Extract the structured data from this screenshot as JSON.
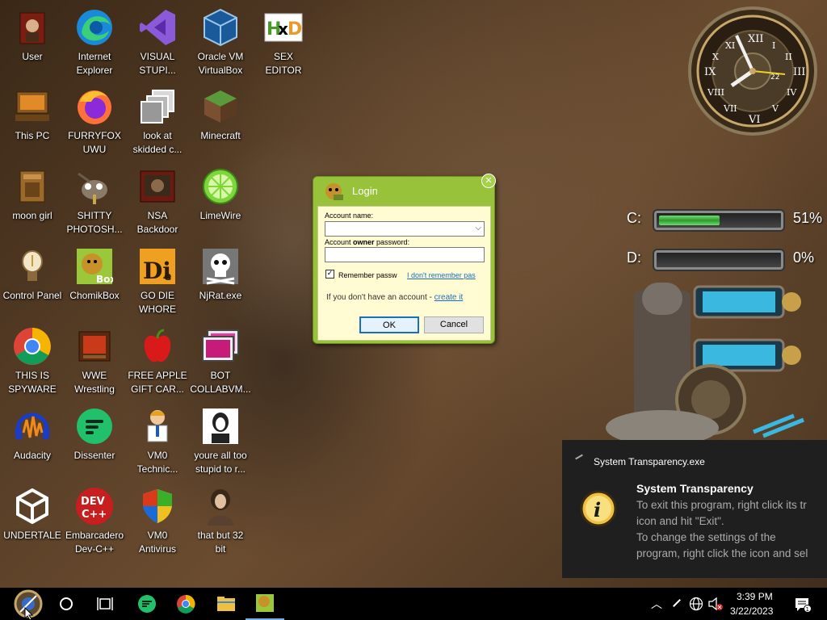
{
  "desktop_icons": [
    {
      "label": "User",
      "icon": "user-folder-icon"
    },
    {
      "label": "Internet\nExplorer",
      "icon": "edge-icon"
    },
    {
      "label": "VISUAL\nSTUPI...",
      "icon": "visual-studio-icon"
    },
    {
      "label": "Oracle VM\nVirtualBox",
      "icon": "virtualbox-icon"
    },
    {
      "label": "SEX\nEDITOR",
      "icon": "hxd-icon"
    },
    {
      "label": "This PC",
      "icon": "this-pc-icon"
    },
    {
      "label": "FURRYFOX\nUWU",
      "icon": "firefox-icon"
    },
    {
      "label": "look at\nskidded c...",
      "icon": "files-icon"
    },
    {
      "label": "Minecraft",
      "icon": "minecraft-icon"
    },
    {
      "label": "moon girl",
      "icon": "folder-icon"
    },
    {
      "label": "SHITTY\nPHOTOSH...",
      "icon": "gimp-icon"
    },
    {
      "label": "NSA\nBackdoor",
      "icon": "nsa-backdoor-icon"
    },
    {
      "label": "LimeWire",
      "icon": "limewire-icon"
    },
    {
      "label": "Control Panel",
      "icon": "control-panel-icon"
    },
    {
      "label": "ChomikBox",
      "icon": "chomikbox-icon"
    },
    {
      "label": "GO DIE\nWHORE",
      "icon": "die-icon"
    },
    {
      "label": "NjRat.exe",
      "icon": "skull-icon"
    },
    {
      "label": "THIS IS\nSPYWARE",
      "icon": "chrome-icon"
    },
    {
      "label": "WWE\nWrestling",
      "icon": "wwe-icon"
    },
    {
      "label": "FREE APPLE\nGIFT CAR...",
      "icon": "apple-icon"
    },
    {
      "label": "BOT\nCOLLABVM...",
      "icon": "bot-collabvm-icon"
    },
    {
      "label": "Audacity",
      "icon": "audacity-icon"
    },
    {
      "label": "Dissenter",
      "icon": "dissenter-icon"
    },
    {
      "label": "VM0\nTechnic...",
      "icon": "vm0-technician-icon"
    },
    {
      "label": "youre all too\nstupid to r...",
      "icon": "portrait-image-icon"
    },
    {
      "label": "UNDERTALE",
      "icon": "unity-icon"
    },
    {
      "label": "Embarcadero\nDev-C++",
      "icon": "devcpp-icon"
    },
    {
      "label": "VM0\nAntivirus",
      "icon": "shield-icon"
    },
    {
      "label": "that but 32\nbit",
      "icon": "painting-icon"
    }
  ],
  "gadgets": {
    "clock_day": "22",
    "drives": [
      {
        "label": "C:",
        "percent_text": "51%",
        "used_fraction": 0.51
      },
      {
        "label": "D:",
        "percent_text": "0%",
        "used_fraction": 0.0
      }
    ]
  },
  "login": {
    "title": "Login",
    "account_name_label": "Account name:",
    "password_label_pre": "Account ",
    "password_label_bold": "owner",
    "password_label_post": " password:",
    "remember_label": "Remember passw",
    "remember_checked": true,
    "forgot_link": "I don't remember pas",
    "no_account_text": "If you don't have an account - ",
    "create_link": "create it",
    "ok": "OK",
    "cancel": "Cancel"
  },
  "toast": {
    "app": "System Transparency.exe",
    "title": "System Transparency",
    "line1": "To exit this program, right click its tr",
    "line2": "icon and hit \"Exit\".",
    "line3": "To change the settings of the",
    "line4": "program, right click the icon and sel"
  },
  "taskbar": {
    "time": "3:39 PM",
    "date": "3/22/2023",
    "items": [
      "start-button",
      "cortana-circle-icon",
      "task-view-icon",
      "dissenter-taskbar-icon",
      "chrome-taskbar-icon",
      "file-explorer-taskbar-icon",
      "chomikbox-taskbar-icon"
    ]
  }
}
